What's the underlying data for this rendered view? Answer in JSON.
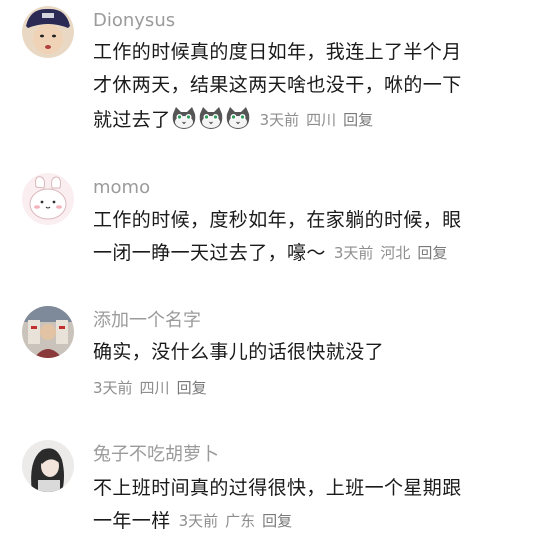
{
  "comments": [
    {
      "username": "Dionysus",
      "lines": [
        "工作的时候真的度日如年，我连上了半个月",
        "才休两天，结果这两天啥也没干，咻的一下",
        "就过去了"
      ],
      "emoji": [
        "cat-face-emoji",
        "cat-face-emoji",
        "cat-face-emoji"
      ],
      "time": "3天前",
      "location": "四川",
      "reply": "回复"
    },
    {
      "username": "momo",
      "lines": [
        "工作的时候，度秒如年，在家躺的时候，眼",
        "一闭一睁一天过去了，嚎～"
      ],
      "time": "3天前",
      "location": "河北",
      "reply": "回复"
    },
    {
      "username": "添加一个名字",
      "lines": [
        "确实，没什么事儿的话很快就没了"
      ],
      "time": "3天前",
      "location": "四川",
      "reply": "回复"
    },
    {
      "username": "兔子不吃胡萝卜",
      "lines": [
        "不上班时间真的过得很快，上班一个星期跟",
        "一年一样"
      ],
      "time": "3天前",
      "location": "广东",
      "reply": "回复"
    }
  ],
  "colors": {
    "username": "#9b9b9b",
    "body_text": "#1a1a1a",
    "meta_text": "#8e8e8e"
  }
}
